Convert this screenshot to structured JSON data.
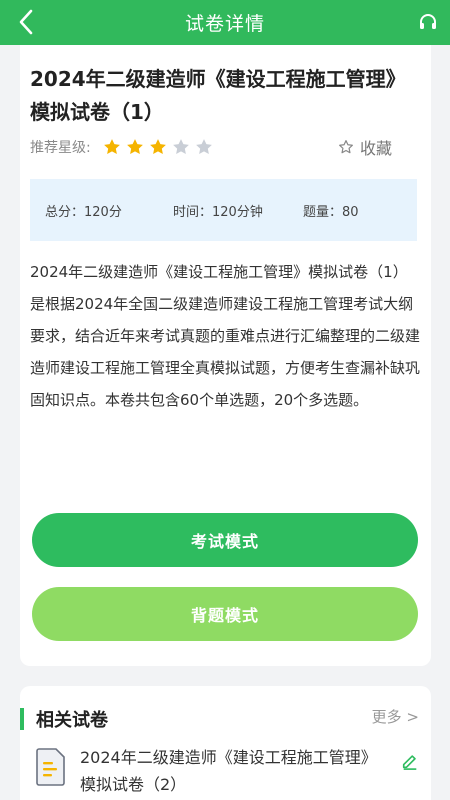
{
  "header": {
    "title": "试卷详情"
  },
  "paper": {
    "title": "2024年二级建造师《建设工程施工管理》模拟试卷（1）",
    "rating_label": "推荐星级:",
    "rating": 3,
    "rating_max": 5,
    "favorite_label": "收藏",
    "total_score": "总分：120分",
    "time": "时间：120分钟",
    "question_count": "题量：80",
    "description": "2024年二级建造师《建设工程施工管理》模拟试卷（1）是根据2024年全国二级建造师建设工程施工管理考试大纲要求，结合近年来考试真题的重难点进行汇编整理的二级建造师建设工程施工管理全真模拟试题，方便考生查漏补缺巩固知识点。本卷共包含60个单选题，20个多选题。"
  },
  "buttons": {
    "exam_mode": "考试模式",
    "recite_mode": "背题模式"
  },
  "related": {
    "title": "相关试卷",
    "more": "更多 >",
    "items": [
      {
        "title": "2024年二级建造师《建设工程施工管理》模拟试卷（2）"
      }
    ]
  },
  "colors": {
    "brand": "#31b95c",
    "star_on": "#f5b400",
    "star_off": "#c9ced6",
    "recite": "#8fdb63"
  }
}
